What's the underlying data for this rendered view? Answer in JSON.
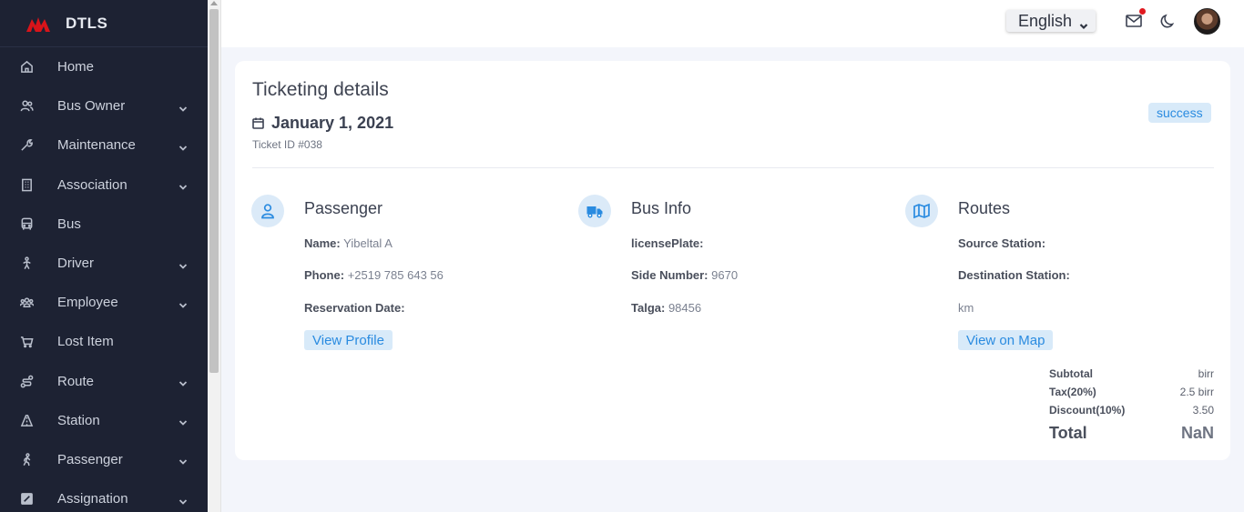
{
  "app": {
    "name": "DTLS"
  },
  "sidebar": {
    "items": [
      {
        "label": "Home",
        "icon": "home-icon",
        "expandable": false
      },
      {
        "label": "Bus Owner",
        "icon": "users-icon",
        "expandable": true
      },
      {
        "label": "Maintenance",
        "icon": "wrench-icon",
        "expandable": true
      },
      {
        "label": "Association",
        "icon": "building-icon",
        "expandable": true
      },
      {
        "label": "Bus",
        "icon": "bus-icon",
        "expandable": false
      },
      {
        "label": "Driver",
        "icon": "driver-icon",
        "expandable": true
      },
      {
        "label": "Employee",
        "icon": "employee-icon",
        "expandable": true
      },
      {
        "label": "Lost Item",
        "icon": "cart-icon",
        "expandable": false
      },
      {
        "label": "Route",
        "icon": "route-icon",
        "expandable": true
      },
      {
        "label": "Station",
        "icon": "station-icon",
        "expandable": true
      },
      {
        "label": "Passenger",
        "icon": "walking-icon",
        "expandable": true
      },
      {
        "label": "Assignation",
        "icon": "assign-icon",
        "expandable": true
      }
    ]
  },
  "header": {
    "language": "English"
  },
  "ticket": {
    "title": "Ticketing details",
    "date": "January 1, 2021",
    "ticket_id": "Ticket ID #038",
    "status": "success"
  },
  "passenger": {
    "title": "Passenger",
    "name_label": "Name:",
    "name_value": "Yibeltal A",
    "phone_label": "Phone:",
    "phone_value": "+2519 785 643 56",
    "reservation_label": "Reservation Date:",
    "reservation_value": "",
    "button": "View Profile"
  },
  "bus_info": {
    "title": "Bus Info",
    "plate_label": "licensePlate:",
    "plate_value": "",
    "side_label": "Side Number:",
    "side_value": "9670",
    "talga_label": "Talga:",
    "talga_value": "98456"
  },
  "routes": {
    "title": "Routes",
    "source_label": "Source Station:",
    "source_value": "",
    "dest_label": "Destination Station:",
    "dest_value": "",
    "distance": "km",
    "button": "View on Map"
  },
  "summary": {
    "subtotal_label": "Subtotal",
    "subtotal_value": "birr",
    "tax_label": "Tax(20%)",
    "tax_value": "2.5 birr",
    "discount_label": "Discount(10%)",
    "discount_value": "3.50",
    "total_label": "Total",
    "total_value": "NaN"
  },
  "colors": {
    "sidebar_bg": "#1d2233",
    "accent": "#2a8be0",
    "accent_bg": "#d8eaf9",
    "page_bg": "#f3f5fb"
  }
}
